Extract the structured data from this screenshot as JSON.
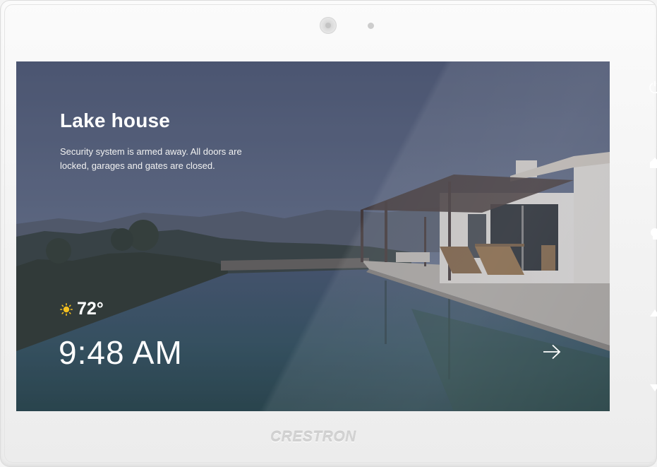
{
  "home": {
    "title": "Lake house",
    "status_text": "Security system is armed away. All doors are locked, garages and gates are closed.",
    "weather_icon": "sun-icon",
    "temperature": "72°",
    "time": "9:48 AM",
    "next_icon": "arrow-right-icon"
  },
  "device": {
    "brand": "CRESTRON",
    "side_buttons": [
      "power-icon",
      "home-icon",
      "lightbulb-icon",
      "volume-up-icon",
      "volume-down-icon"
    ]
  },
  "colors": {
    "sky": "#5c6a86",
    "water": "#3e6170",
    "sun": "#f4c020",
    "bezel": "#f4f4f4",
    "text": "#ffffff"
  }
}
